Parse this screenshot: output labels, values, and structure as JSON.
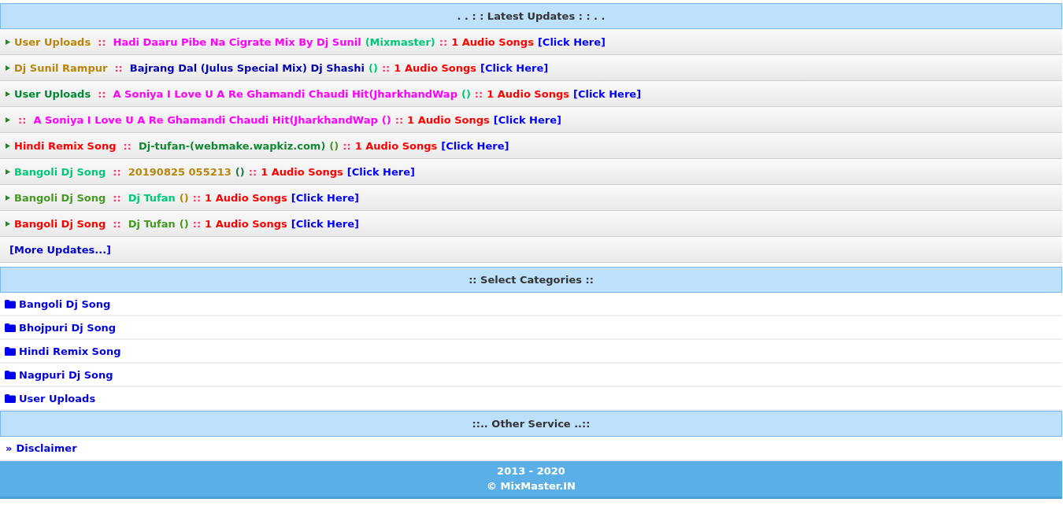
{
  "latest_updates": {
    "title": ". . : : Latest Updates : : . .",
    "items": [
      {
        "category": {
          "text": "User Uploads",
          "color": "#b8860b"
        },
        "separator": "::",
        "title": {
          "text": "Hadi Daaru Pibe Na Cigrate Mix By Dj Sunil",
          "color": "#ff00ff"
        },
        "artist": {
          "text": "(Mixmaster)",
          "color": "#00c878"
        },
        "separator_2": "::",
        "count": "1 Audio Songs",
        "link": "[Click Here]"
      },
      {
        "category": {
          "text": "Dj Sunil Rampur",
          "color": "#b8860b"
        },
        "separator": "::",
        "title": {
          "text": "Bajrang Dal (Julus Special Mix) Dj Shashi",
          "color": "#0000b0"
        },
        "artist": {
          "text": "()",
          "color": "#00c878"
        },
        "separator_2": "::",
        "count": "1 Audio Songs",
        "link": "[Click Here]"
      },
      {
        "category": {
          "text": "User Uploads",
          "color": "#008833"
        },
        "separator": "::",
        "title": {
          "text": "A Soniya I Love U A Re Ghamandi Chaudi Hit(JharkhandWap",
          "color": "#ff00ff"
        },
        "artist": {
          "text": "()",
          "color": "#00c878"
        },
        "separator_2": "::",
        "count": "1 Audio Songs",
        "link": "[Click Here]"
      },
      {
        "separator": "::",
        "title": {
          "text": "A Soniya I Love U A Re Ghamandi Chaudi Hit(JharkhandWap",
          "color": "#ff00ff"
        },
        "artist": {
          "text": "()",
          "color": "#ff00ff"
        },
        "separator_2": "::",
        "count": "1 Audio Songs",
        "link": "[Click Here]"
      },
      {
        "category": {
          "text": "Hindi Remix Song",
          "color": "#ff0000"
        },
        "separator": "::",
        "title": {
          "text": "Dj-tufan-(webmake.wapkiz.com)",
          "color": "#118833"
        },
        "artist": {
          "text": "()",
          "color": "#449922"
        },
        "separator_2": "::",
        "count": "1 Audio Songs",
        "link": "[Click Here]"
      },
      {
        "category": {
          "text": "Bangoli Dj Song",
          "color": "#00c878"
        },
        "separator": "::",
        "title": {
          "text": "20190825 055213",
          "color": "#b8860b"
        },
        "artist": {
          "text": "()",
          "color": "#227744"
        },
        "separator_2": "::",
        "count": "1 Audio Songs",
        "link": "[Click Here]"
      },
      {
        "category": {
          "text": "Bangoli Dj Song",
          "color": "#449922"
        },
        "separator": "::",
        "title": {
          "text": "Dj Tufan",
          "color": "#00c878"
        },
        "artist": {
          "text": "()",
          "color": "#b8860b"
        },
        "separator_2": "::",
        "count": "1 Audio Songs",
        "link": "[Click Here]"
      },
      {
        "category": {
          "text": "Bangoli Dj Song",
          "color": "#ff0000"
        },
        "separator": "::",
        "title": {
          "text": "Dj Tufan",
          "color": "#449922"
        },
        "artist": {
          "text": "()",
          "color": "#449922"
        },
        "separator_2": "::",
        "count": "1 Audio Songs",
        "link": "[Click Here]"
      }
    ],
    "more_link": "[More Updates...]"
  },
  "categories": {
    "title": ":: Select Categories ::",
    "items": [
      "Bangoli Dj Song",
      "Bhojpuri Dj Song",
      "Hindi Remix Song",
      "Nagpuri Dj Song",
      "User Uploads"
    ]
  },
  "other_service": {
    "title": "::.. Other Service ..::",
    "items": [
      {
        "marker": "»",
        "label": "Disclaimer"
      }
    ]
  },
  "footer": {
    "years": "2013 - 2020",
    "copyright": "© MixMaster.IN"
  }
}
